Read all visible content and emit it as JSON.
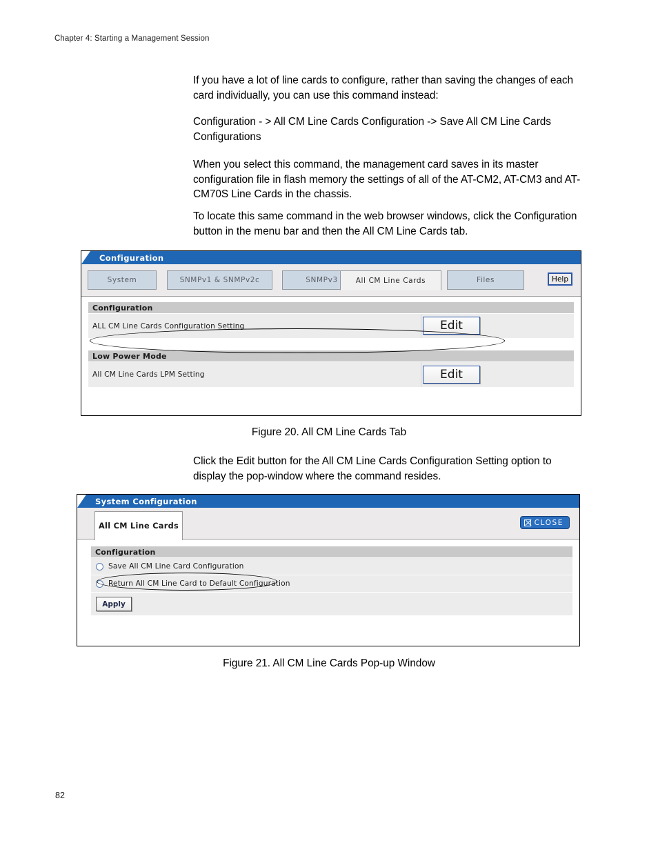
{
  "page": {
    "chapter_header": "Chapter 4: Starting a Management Session",
    "number": "82"
  },
  "body": {
    "paragraphs": [
      "If you have a lot of line cards to configure, rather than saving the changes of each card individually, you can use this command instead:",
      "Configuration - > All CM Line Cards Configuration -> Save All CM Line Cards Configurations",
      "When you select this command, the management card saves in its master configuration file in flash memory the settings of all of the AT-CM2, AT-CM3 and AT-CM70S Line Cards in the chassis.",
      "To locate this same command in the web browser windows, click the Configuration button in the menu bar and then the All CM Line Cards tab."
    ],
    "after_figure20": "Click the Edit button for the All CM Line Cards Configuration Setting option to display the pop-window where the command resides."
  },
  "figure20": {
    "caption": "Figure 20. All CM Line Cards Tab",
    "window_title": "Configuration",
    "tabs": [
      {
        "label": "System",
        "active": false
      },
      {
        "label": "SNMPv1 & SNMPv2c",
        "active": false
      },
      {
        "label": "SNMPv3",
        "active": false
      },
      {
        "label": "All CM Line Cards",
        "active": true
      },
      {
        "label": "Files",
        "active": false
      }
    ],
    "help_label": "Help",
    "sections": [
      {
        "heading": "Configuration",
        "row_label": "ALL CM Line Cards Configuration Setting",
        "button_label": "Edit",
        "highlighted": true
      },
      {
        "heading": "Low Power Mode",
        "row_label": "All CM Line Cards LPM Setting",
        "button_label": "Edit",
        "highlighted": false
      }
    ]
  },
  "figure21": {
    "caption": "Figure 21. All CM Line Cards Pop-up Window",
    "window_title": "System Configuration",
    "tab_label": "All CM Line Cards",
    "close_label": "CLOSE",
    "section_heading": "Configuration",
    "options": [
      {
        "label": "Save All CM Line Card Configuration",
        "selected": false,
        "highlighted": true
      },
      {
        "label": "Return All CM Line Card to Default Configuration",
        "selected": false,
        "highlighted": false
      }
    ],
    "apply_label": "Apply"
  },
  "colors": {
    "title_bar_blue": "#1f66b5",
    "accent_blue": "#2a6fc0",
    "tab_fill": "#ccd7e4",
    "section_head_gray": "#c9c9c9",
    "row_gray": "#ececec"
  }
}
